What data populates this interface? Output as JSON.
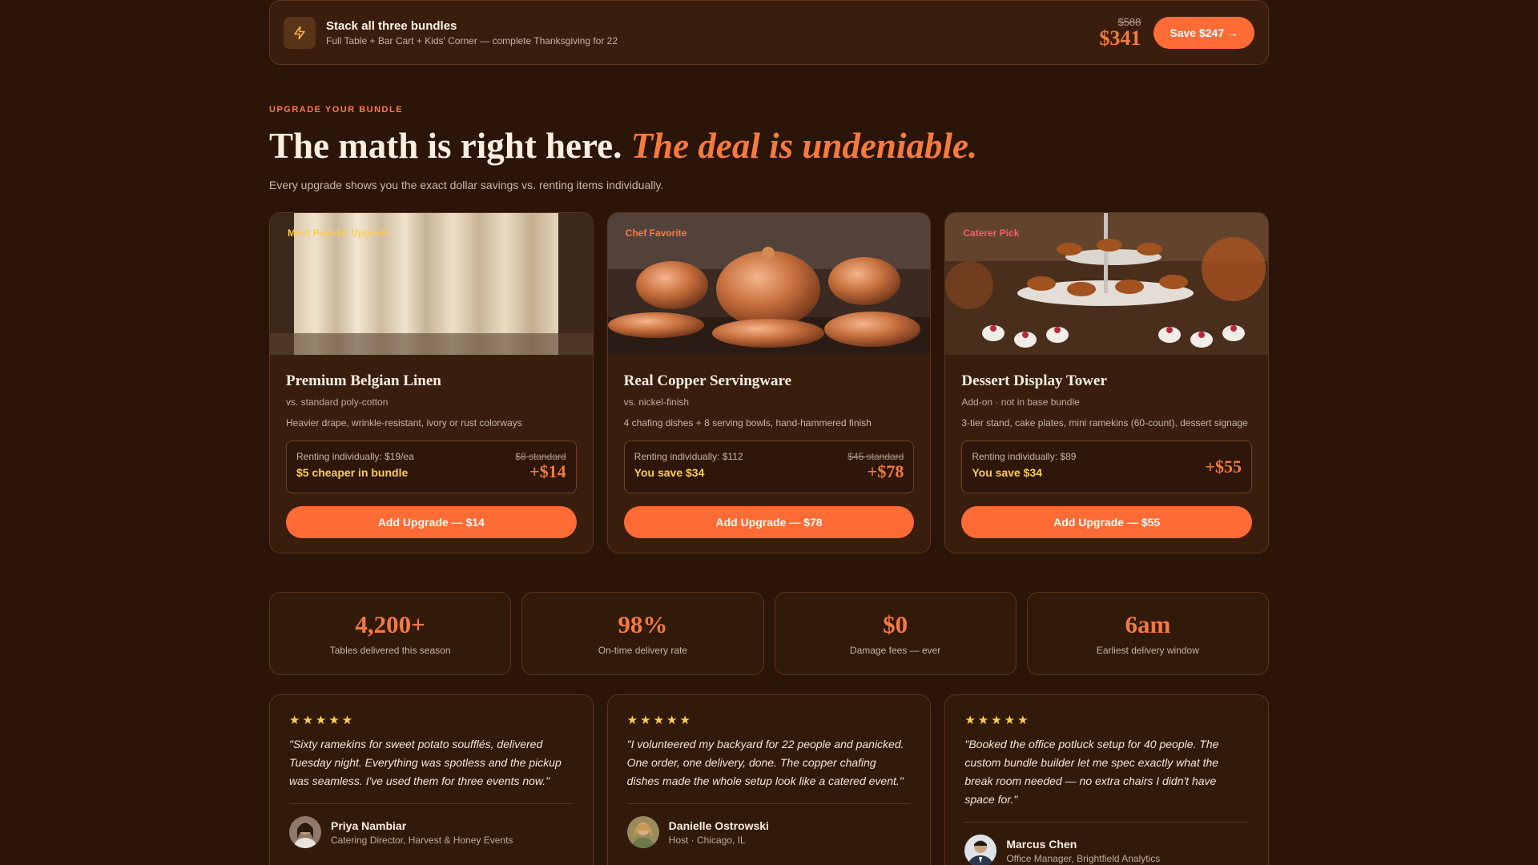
{
  "colors": {
    "background": "#2b1508",
    "accent": "#ff6b35",
    "accent_text": "#f47a3f",
    "gold": "#ffcc4d",
    "card": "#3a1e0d"
  },
  "stack": {
    "icon": "lightning-bolt-icon",
    "title": "Stack all three bundles",
    "subtitle": "Full Table + Bar Cart + Kids' Corner — complete Thanksgiving for 22",
    "old_price": "$588",
    "new_price": "$341",
    "button": "Save $247 →"
  },
  "hero": {
    "eyebrow": "UPGRADE YOUR BUNDLE",
    "headline_plain": "The math is right here.",
    "headline_accent": "The deal is undeniable.",
    "lede": "Every upgrade shows you the exact dollar savings vs. renting items individually."
  },
  "cards": [
    {
      "badge": "Most Popular Upgrade",
      "badge_color": "#ffcc4d",
      "title": "Premium Belgian Linen",
      "vs": "vs. standard poly-cotton",
      "desc": "Heavier drape, wrinkle-resistant, ivory or rust colorways",
      "rent": "Renting individually: $19/ea",
      "save": "$5 cheaper in bundle",
      "standard": "$8 standard",
      "add": "+$14",
      "button": "Add Upgrade — $14"
    },
    {
      "badge": "Chef Favorite",
      "badge_color": "#ff7a45",
      "title": "Real Copper Servingware",
      "vs": "vs. nickel-finish",
      "desc": "4 chafing dishes + 8 serving bowls, hand-hammered finish",
      "rent": "Renting individually: $112",
      "save": "You save $34",
      "standard": "$45 standard",
      "add": "+$78",
      "button": "Add Upgrade — $78"
    },
    {
      "badge": "Caterer Pick",
      "badge_color": "#ff5b6e",
      "title": "Dessert Display Tower",
      "vs": "Add-on · not in base bundle",
      "desc": "3-tier stand, cake plates, mini ramekins (60-count), dessert signage",
      "rent": "Renting individually: $89",
      "save": "You save $34",
      "standard": "",
      "add": "+$55",
      "button": "Add Upgrade — $55"
    }
  ],
  "stats": [
    {
      "value": "4,200+",
      "label": "Tables delivered this season"
    },
    {
      "value": "98%",
      "label": "On-time delivery rate"
    },
    {
      "value": "$0",
      "label": "Damage fees — ever"
    },
    {
      "value": "6am",
      "label": "Earliest delivery window"
    }
  ],
  "testimonials": [
    {
      "rating": 5,
      "stars": "★★★★★",
      "quote": "\"Sixty ramekins for sweet potato soufflés, delivered Tuesday night. Everything was spotless and the pickup was seamless. I've used them for three events now.\"",
      "name": "Priya Nambiar",
      "role": "Catering Director, Harvest & Honey Events"
    },
    {
      "rating": 5,
      "stars": "★★★★★",
      "quote": "\"I volunteered my backyard for 22 people and panicked. One order, one delivery, done. The copper chafing dishes made the whole setup look like a catered event.\"",
      "name": "Danielle Ostrowski",
      "role": "Host · Chicago, IL"
    },
    {
      "rating": 5,
      "stars": "★★★★★",
      "quote": "\"Booked the office potluck setup for 40 people. The custom bundle builder let me spec exactly what the break room needed — no extra chairs I didn't have space for.\"",
      "name": "Marcus Chen",
      "role": "Office Manager, Brightfield Analytics"
    }
  ]
}
